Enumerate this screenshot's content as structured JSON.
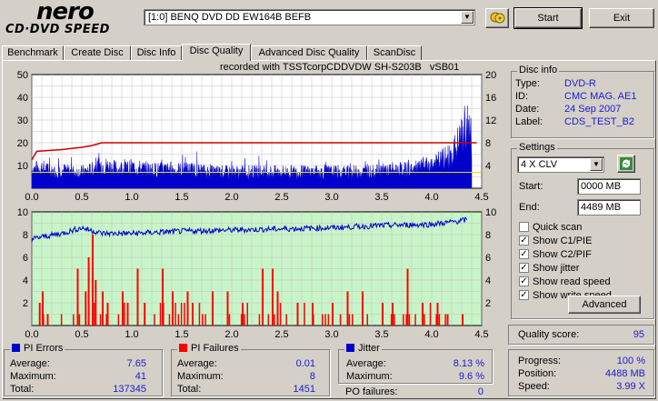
{
  "app": {
    "logo_top": "nero",
    "logo_bottom": "CD·DVD SPEED"
  },
  "toolbar": {
    "drive": "[1:0]  BENQ DVD DD EW164B BEFB",
    "start_label": "Start",
    "exit_label": "Exit"
  },
  "tabs": [
    "Benchmark",
    "Create Disc",
    "Disc Info",
    "Disc Quality",
    "Advanced Disc Quality",
    "ScanDisc"
  ],
  "active_tab": "Disc Quality",
  "recorded_with": "recorded with TSSTcorpCDDVDW SH-S203B   vSB01",
  "disc_info": {
    "title": "Disc info",
    "rows": [
      {
        "label": "Type:",
        "value": "DVD-R"
      },
      {
        "label": "ID:",
        "value": "CMC MAG. AE1"
      },
      {
        "label": "Date:",
        "value": "24 Sep 2007"
      },
      {
        "label": "Label:",
        "value": "CDS_TEST_B2"
      }
    ]
  },
  "settings": {
    "title": "Settings",
    "speed": "4 X CLV",
    "start_label": "Start:",
    "start_value": "0000 MB",
    "end_label": "End:",
    "end_value": "4489 MB",
    "options": [
      {
        "label": "Quick scan",
        "checked": false
      },
      {
        "label": "Show C1/PIE",
        "checked": true
      },
      {
        "label": "Show C2/PIF",
        "checked": true
      },
      {
        "label": "Show jitter",
        "checked": true
      },
      {
        "label": "Show read speed",
        "checked": true
      },
      {
        "label": "Show write speed",
        "checked": true
      }
    ],
    "advanced_label": "Advanced"
  },
  "quality": {
    "label": "Quality score:",
    "value": "95"
  },
  "progress": {
    "rows": [
      {
        "label": "Progress:",
        "value": "100 %"
      },
      {
        "label": "Position:",
        "value": "4488 MB"
      },
      {
        "label": "Speed:",
        "value": "3.99 X"
      }
    ]
  },
  "pi_errors": {
    "title": "PI Errors",
    "rows": [
      {
        "label": "Average:",
        "value": "7.65"
      },
      {
        "label": "Maximum:",
        "value": "41"
      },
      {
        "label": "Total:",
        "value": "137345"
      }
    ]
  },
  "pi_failures": {
    "title": "PI Failures",
    "rows": [
      {
        "label": "Average:",
        "value": "0.01"
      },
      {
        "label": "Maximum:",
        "value": "8"
      },
      {
        "label": "Total:",
        "value": "1451"
      }
    ]
  },
  "jitter": {
    "title": "Jitter",
    "rows": [
      {
        "label": "Average:",
        "value": "8.13 %"
      },
      {
        "label": "Maximum:",
        "value": "9.6 %"
      }
    ]
  },
  "po_failures": {
    "label": "PO failures:",
    "value": "0"
  },
  "colors": {
    "pie": "#0000cc",
    "pif": "#ff0000",
    "jitter": "#0000cc",
    "speed": "#cc0000",
    "accent_value": "#1b1bd1",
    "top_bg": "#ffffff",
    "bottom_bg": "#c8f5c8"
  },
  "chart_data": [
    {
      "type": "area",
      "series": [
        {
          "values_desc": "PI errors per ECC block",
          "x": [
            0.0,
            0.1,
            0.2,
            0.3,
            0.4,
            0.5,
            0.6,
            0.7,
            0.8,
            0.9,
            1.0,
            1.2,
            1.4,
            1.6,
            1.8,
            2.0,
            2.2,
            2.4,
            2.6,
            2.8,
            3.0,
            3.2,
            3.4,
            3.6,
            3.8,
            4.0,
            4.1,
            4.2,
            4.3,
            4.35,
            4.38,
            4.4
          ],
          "values": [
            8,
            9,
            7,
            8,
            7,
            7,
            8,
            10,
            9,
            8,
            9,
            8,
            8,
            8,
            7,
            7,
            7,
            7,
            7,
            7,
            7,
            7,
            7,
            8,
            8,
            10,
            12,
            14,
            22,
            28,
            25,
            20
          ]
        },
        {
          "values_desc": "read speed",
          "x": [
            0.0,
            0.05,
            0.3,
            0.5,
            0.6,
            0.7,
            4.45
          ],
          "values": [
            5,
            6.5,
            6.8,
            7.2,
            7.5,
            8,
            8
          ]
        }
      ],
      "xlim": [
        0,
        4.5
      ],
      "ylim_left": [
        0,
        50
      ],
      "ylim_right": [
        0,
        20
      ],
      "x_ticks": [
        "0.0",
        "0.5",
        "1.0",
        "1.5",
        "2.0",
        "2.5",
        "3.0",
        "3.5",
        "4.0",
        "4.5"
      ],
      "y_left_ticks": [
        "10",
        "20",
        "30",
        "40",
        "50"
      ],
      "y_right_ticks": [
        "4",
        "8",
        "12",
        "16",
        "20"
      ]
    },
    {
      "type": "bar",
      "series": [
        {
          "values_desc": "PI failures",
          "x": [
            0.07,
            0.1,
            0.15,
            0.45,
            0.53,
            0.56,
            0.6,
            0.63,
            0.7,
            0.75,
            0.9,
            0.95,
            1.05,
            1.12,
            1.3,
            1.4,
            1.55,
            1.6,
            1.8,
            1.95,
            2.1,
            2.3,
            2.4,
            2.45,
            2.65,
            2.8,
            3.0,
            3.15,
            3.3,
            3.5,
            3.6,
            3.75,
            3.9,
            4.05,
            4.15,
            4.3
          ],
          "values": [
            2,
            3,
            1,
            5,
            3,
            6,
            8,
            4,
            3,
            2,
            3,
            2,
            5,
            2,
            5,
            3,
            3,
            2,
            3,
            3,
            2,
            5,
            5,
            3,
            2,
            2,
            2,
            3,
            3,
            2,
            2,
            5,
            2,
            2,
            1,
            1
          ]
        },
        {
          "values_desc": "jitter",
          "x": [
            0.0,
            0.1,
            0.3,
            0.5,
            0.7,
            1.0,
            1.5,
            2.0,
            2.5,
            3.0,
            3.5,
            4.0,
            4.2,
            4.35
          ],
          "values": [
            7.6,
            7.8,
            8.1,
            8.6,
            8.1,
            8.1,
            8.3,
            8.4,
            8.5,
            8.6,
            8.8,
            8.9,
            9.1,
            9.3
          ]
        }
      ],
      "xlim": [
        0,
        4.5
      ],
      "ylim_left": [
        0,
        10
      ],
      "ylim_right": [
        0,
        10
      ],
      "x_ticks": [
        "0.0",
        "0.5",
        "1.0",
        "1.5",
        "2.0",
        "2.5",
        "3.0",
        "3.5",
        "4.0",
        "4.5"
      ],
      "y_left_ticks": [
        "2",
        "4",
        "6",
        "8",
        "10"
      ],
      "y_right_ticks": [
        "2",
        "4",
        "6",
        "8",
        "10"
      ]
    }
  ]
}
